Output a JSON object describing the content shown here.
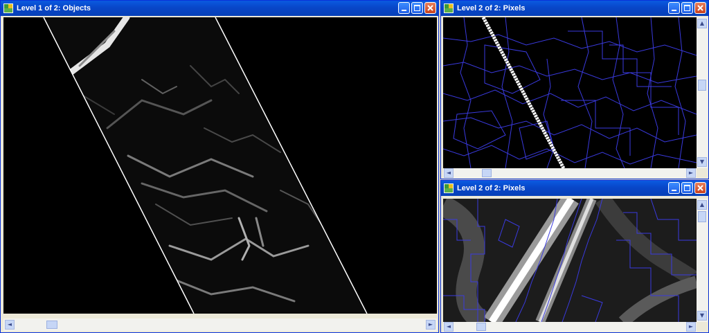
{
  "windows": [
    {
      "id": "objects",
      "title": "Level 1 of 2: Objects"
    },
    {
      "id": "pixels_top",
      "title": "Level 2 of 2: Pixels"
    },
    {
      "id": "pixels_bottom",
      "title": "Level 2 of 2: Pixels"
    }
  ],
  "titlebar_buttons": {
    "minimize_icon": "minimize-icon",
    "maximize_icon": "maximize-icon",
    "close_icon": "close-icon"
  },
  "scroll_glyphs": {
    "left": "◄",
    "right": "►",
    "up": "▲",
    "down": "▼"
  },
  "colors": {
    "titlebar": "#0846c8",
    "segment_outline": "#3a3adf",
    "canvas": "#000000",
    "scroll_track": "#f2f2ee"
  }
}
